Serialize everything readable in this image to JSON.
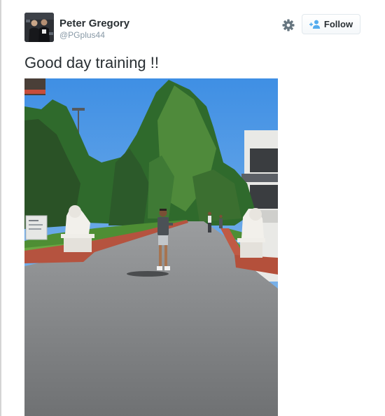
{
  "tweet": {
    "author_name": "Peter Gregory",
    "author_handle": "@PGplus44",
    "text": "Good day training !!",
    "follow_label": "Follow",
    "avatar_icon": "profile-photo",
    "settings_icon": "gear-icon",
    "follow_icon": "add-user-icon",
    "photo_alt": ""
  },
  "colors": {
    "accent": "#55acee",
    "text": "#292f33",
    "muted": "#8899a6"
  }
}
